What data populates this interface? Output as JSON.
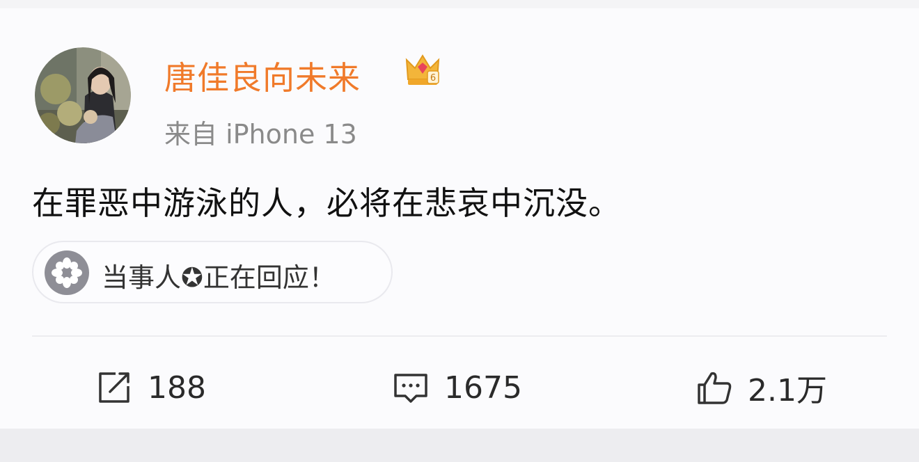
{
  "post": {
    "username": "唐佳良向未来",
    "source": "来自 iPhone 13",
    "text": "在罪恶中游泳的人，必将在悲哀中沉没。",
    "topic_chip": "当事人✪正在回应！",
    "user_badge": "crown-level-6-icon",
    "badge_level": "6"
  },
  "actions": {
    "repost_count": "188",
    "comment_count": "1675",
    "like_count": "2.1万"
  },
  "colors": {
    "username": "#f07a2a",
    "secondary_text": "#8a8a8a",
    "card_bg": "#fbfbfd",
    "chip_icon_bg": "#8e8e96"
  }
}
